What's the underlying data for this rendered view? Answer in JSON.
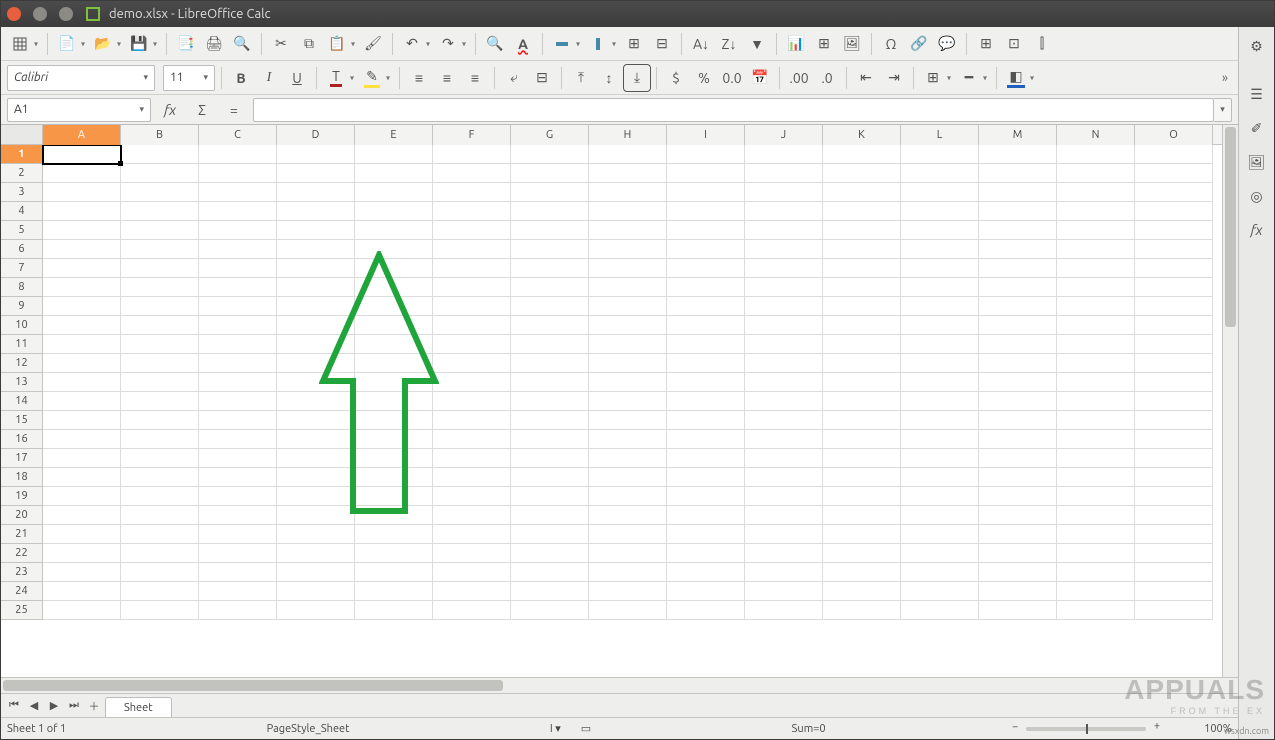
{
  "window": {
    "title": "demo.xlsx - LibreOffice Calc"
  },
  "toolbar1": {
    "icons": [
      "table-icon",
      "new-icon",
      "open-icon",
      "save-icon",
      "print-icon",
      "export-pdf-icon",
      "print-preview-icon",
      "cut-icon",
      "copy-icon",
      "paste-icon",
      "clone-format-icon",
      "undo-icon",
      "redo-icon",
      "find-icon",
      "spellcheck-icon",
      "row-icon",
      "column-icon",
      "cell-icon",
      "merge-icon",
      "sort-asc-icon",
      "sort-desc-icon",
      "autofilter-icon",
      "chart-icon",
      "pivot-icon",
      "image-icon",
      "special-char-icon",
      "hyperlink-icon",
      "comment-icon",
      "headers-icon",
      "freeze-icon",
      "split-icon"
    ]
  },
  "toolbar2": {
    "font_name": "Calibri",
    "font_size": "11",
    "buttons": {
      "bold": "B",
      "italic": "I",
      "turkey": "U",
      "currency": "$",
      "percent": "%"
    }
  },
  "formula_bar": {
    "namebox": "A1",
    "fx_label": "fx",
    "sigma_label": "Σ",
    "eq_label": "="
  },
  "columns": [
    "A",
    "B",
    "C",
    "D",
    "E",
    "F",
    "G",
    "H",
    "I",
    "J",
    "K",
    "L",
    "M",
    "N",
    "O"
  ],
  "rows": [
    1,
    2,
    3,
    4,
    5,
    6,
    7,
    8,
    9,
    10,
    11,
    12,
    13,
    14,
    15,
    16,
    17,
    18,
    19,
    20,
    21,
    22,
    23,
    24,
    25
  ],
  "active_cell": {
    "col": "A",
    "row": 1
  },
  "sheet_tab": "Sheet",
  "status": {
    "sheet_info": "Sheet 1 of 1",
    "page_style": "PageStyle_Sheet",
    "sum": "Sum=0",
    "zoom": "100%"
  },
  "sidebar_fx": "fx",
  "watermark": {
    "brand": "APPUALS",
    "tag": "FROM THE EX",
    "src": "wsxdn.com"
  }
}
